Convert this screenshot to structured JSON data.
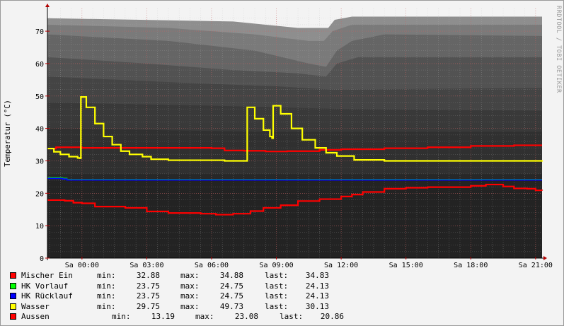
{
  "watermark": "RRDTOOL / TOBI OETIKER",
  "chart_data": {
    "type": "line",
    "title": "",
    "xlabel": "",
    "ylabel": "Temperatur (°C)",
    "ylim": [
      0,
      77
    ],
    "xlim": [
      -1.6,
      21.3
    ],
    "grid": true,
    "legend_placement": "bottom",
    "yticks": [
      0,
      10,
      20,
      30,
      40,
      50,
      60,
      70
    ],
    "xticks": [
      {
        "t": 0,
        "label": "Sa 00:00"
      },
      {
        "t": 3,
        "label": "Sa 03:00"
      },
      {
        "t": 6,
        "label": "Sa 06:00"
      },
      {
        "t": 9,
        "label": "Sa 09:00"
      },
      {
        "t": 12,
        "label": "Sa 12:00"
      },
      {
        "t": 15,
        "label": "Sa 15:00"
      },
      {
        "t": 18,
        "label": "Sa 18:00"
      },
      {
        "t": 21,
        "label": "Sa 21:00"
      }
    ],
    "series": [
      {
        "name": "Mischer Ein",
        "color": "#ff0000",
        "min": "32.88",
        "max": "34.88",
        "last": "34.83",
        "points": [
          [
            -1.6,
            33.8
          ],
          [
            -1.2,
            34.2
          ],
          [
            0,
            34.0
          ],
          [
            3,
            34.0
          ],
          [
            6,
            33.9
          ],
          [
            6.6,
            33.2
          ],
          [
            7.5,
            33.1
          ],
          [
            8.5,
            32.9
          ],
          [
            9.5,
            33.0
          ],
          [
            11,
            33.4
          ],
          [
            12,
            33.6
          ],
          [
            14,
            33.9
          ],
          [
            16,
            34.2
          ],
          [
            18,
            34.6
          ],
          [
            20,
            34.8
          ],
          [
            21.3,
            34.8
          ]
        ]
      },
      {
        "name": "HK Vorlauf",
        "color": "#00ff00",
        "min": "23.75",
        "max": "24.75",
        "last": "24.13",
        "points": [
          [
            -1.6,
            24.8
          ],
          [
            -0.9,
            24.6
          ],
          [
            -0.7,
            24.2
          ],
          [
            21.3,
            24.2
          ]
        ]
      },
      {
        "name": "HK Rücklauf",
        "color": "#0000ff",
        "min": "23.75",
        "max": "24.75",
        "last": "24.13",
        "points": [
          [
            -1.6,
            24.6
          ],
          [
            -0.9,
            24.4
          ],
          [
            -0.7,
            24.1
          ],
          [
            21.3,
            24.1
          ]
        ]
      },
      {
        "name": "Wasser",
        "color": "#ffff00",
        "min": "29.75",
        "max": "49.73",
        "last": "30.13",
        "points": [
          [
            -1.6,
            33.8
          ],
          [
            -1.3,
            32.8
          ],
          [
            -1.0,
            32.0
          ],
          [
            -0.6,
            31.3
          ],
          [
            -0.2,
            30.9
          ],
          [
            -0.1,
            30.8
          ],
          [
            -0.05,
            49.7
          ],
          [
            0.2,
            46.5
          ],
          [
            0.6,
            41.5
          ],
          [
            1.0,
            37.5
          ],
          [
            1.4,
            35.0
          ],
          [
            1.8,
            33.0
          ],
          [
            2.2,
            32.0
          ],
          [
            2.8,
            31.3
          ],
          [
            3.2,
            30.5
          ],
          [
            4,
            30.2
          ],
          [
            6.6,
            30.0
          ],
          [
            7.6,
            30.0
          ],
          [
            7.65,
            46.5
          ],
          [
            8.0,
            43.0
          ],
          [
            8.4,
            39.5
          ],
          [
            8.7,
            37.5
          ],
          [
            8.8,
            37.0
          ],
          [
            8.85,
            47.0
          ],
          [
            9.2,
            44.5
          ],
          [
            9.7,
            40.0
          ],
          [
            10.2,
            36.5
          ],
          [
            10.8,
            34.0
          ],
          [
            11.3,
            32.5
          ],
          [
            11.8,
            31.5
          ],
          [
            12.6,
            30.3
          ],
          [
            14,
            30.0
          ],
          [
            17,
            30.0
          ],
          [
            21.3,
            30.2
          ]
        ]
      },
      {
        "name": "Aussen",
        "color": "#ff0000",
        "min": "13.19",
        "max": "23.08",
        "last": "20.86",
        "points": [
          [
            -1.6,
            17.9
          ],
          [
            -0.8,
            17.7
          ],
          [
            -0.4,
            17.1
          ],
          [
            0,
            16.9
          ],
          [
            0.6,
            15.9
          ],
          [
            2,
            15.5
          ],
          [
            3,
            14.4
          ],
          [
            4,
            13.9
          ],
          [
            5.5,
            13.7
          ],
          [
            6.2,
            13.4
          ],
          [
            7,
            13.7
          ],
          [
            7.8,
            14.5
          ],
          [
            8.4,
            15.5
          ],
          [
            9.2,
            16.3
          ],
          [
            10,
            17.6
          ],
          [
            11,
            18.2
          ],
          [
            12,
            19.0
          ],
          [
            12.5,
            19.6
          ],
          [
            13,
            20.4
          ],
          [
            14,
            21.4
          ],
          [
            15,
            21.7
          ],
          [
            16,
            21.9
          ],
          [
            17,
            21.9
          ],
          [
            18,
            22.3
          ],
          [
            18.7,
            22.7
          ],
          [
            19.2,
            22.7
          ],
          [
            19.5,
            22.1
          ],
          [
            20,
            21.5
          ],
          [
            20.6,
            21.4
          ],
          [
            21,
            20.9
          ],
          [
            21.3,
            20.8
          ]
        ]
      }
    ]
  }
}
